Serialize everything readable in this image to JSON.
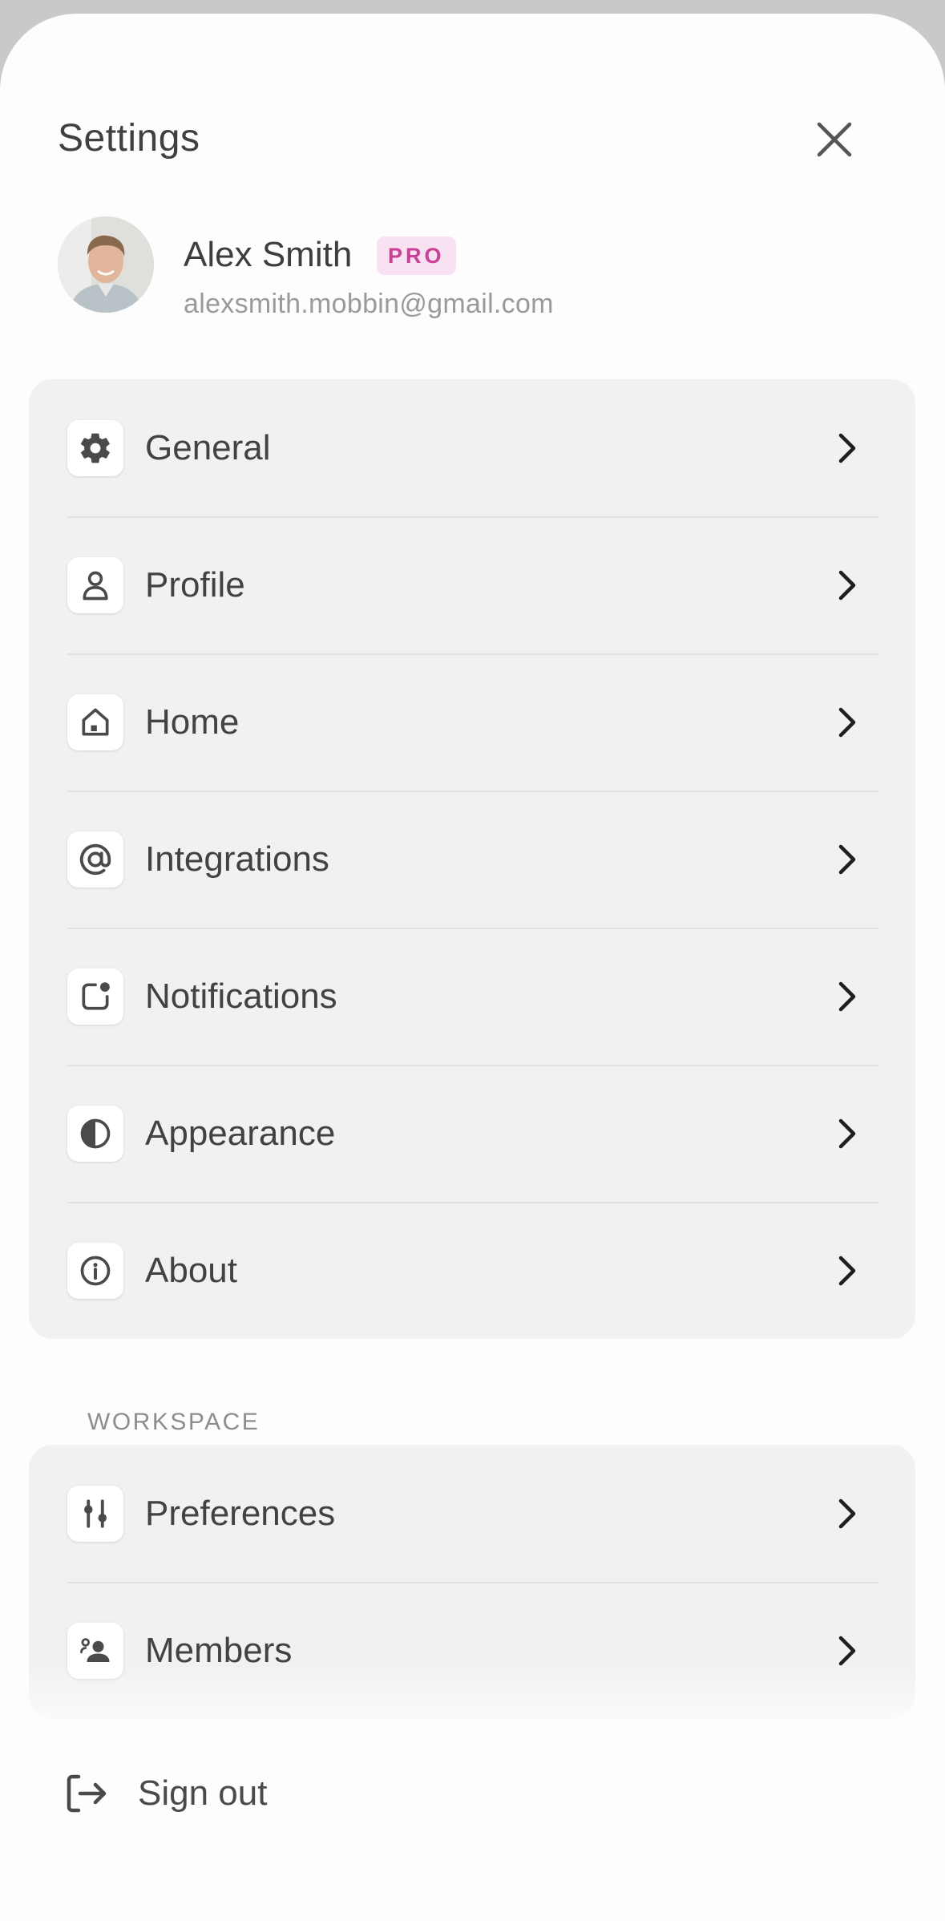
{
  "header": {
    "title": "Settings",
    "close_icon": "close-icon"
  },
  "user": {
    "name": "Alex Smith",
    "badge": "PRO",
    "email": "alexsmith.mobbin@gmail.com"
  },
  "main_menu": [
    {
      "label": "General",
      "icon": "gear-icon"
    },
    {
      "label": "Profile",
      "icon": "person-icon"
    },
    {
      "label": "Home",
      "icon": "house-icon"
    },
    {
      "label": "Integrations",
      "icon": "at-sign-icon"
    },
    {
      "label": "Notifications",
      "icon": "notification-dot-icon"
    },
    {
      "label": "Appearance",
      "icon": "half-circle-icon"
    },
    {
      "label": "About",
      "icon": "info-icon"
    }
  ],
  "workspace": {
    "section_label": "WORKSPACE",
    "items": [
      {
        "label": "Preferences",
        "icon": "sliders-icon"
      },
      {
        "label": "Members",
        "icon": "members-icon"
      }
    ]
  },
  "footer": {
    "sign_out_label": "Sign out",
    "icon": "sign-out-icon"
  },
  "colors": {
    "background": "#fdfdfd",
    "card": "#f1f1f1",
    "badge_bg": "#f8e1f0",
    "badge_text": "#cc3f94",
    "text": "#424242"
  }
}
